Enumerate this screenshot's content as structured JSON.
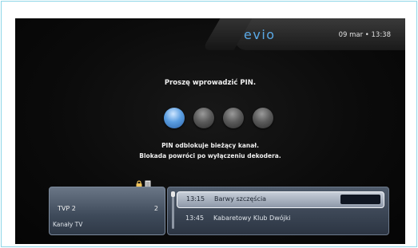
{
  "header": {
    "logo": "evio",
    "datetime": "09 mar • 13:38"
  },
  "pin": {
    "prompt": "Proszę wprowadzić PIN.",
    "entered_digits": 1,
    "total_digits": 4,
    "message_line1": "PIN odblokuje bieżący kanał.",
    "message_line2": "Blokada powróci po wyłączeniu dekodera."
  },
  "channel": {
    "name": "TVP 2",
    "number": "2",
    "category": "Kanały TV"
  },
  "epg": {
    "programs": [
      {
        "time": "13:15",
        "title": "Barwy szczęścia"
      },
      {
        "time": "13:45",
        "title": "Kabaretowy Klub Dwójki"
      }
    ]
  },
  "colors": {
    "accent": "#5a9de0",
    "logo": "#5aa9e6"
  }
}
